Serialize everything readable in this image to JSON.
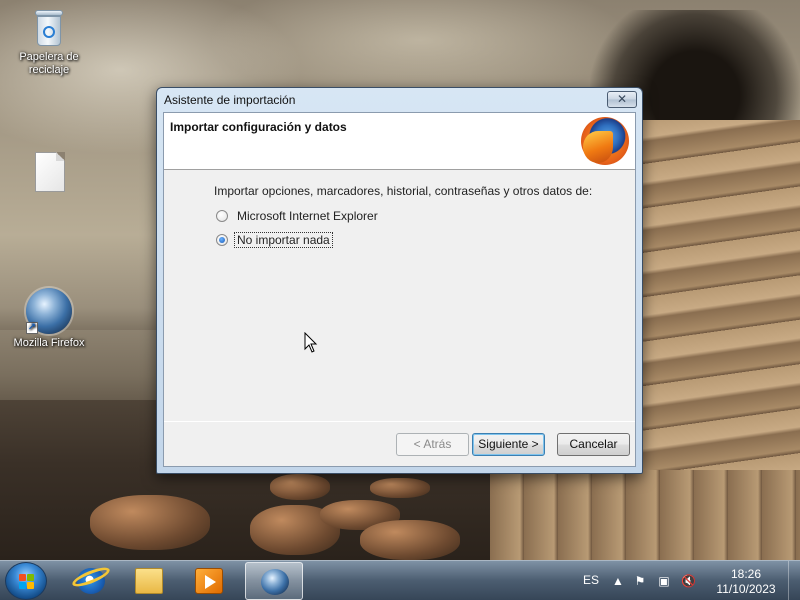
{
  "desktop": {
    "icons": [
      {
        "label": "Papelera de reciclaje",
        "icon": "recycle-bin-icon"
      },
      {
        "label": "",
        "icon": "blank-file-icon"
      },
      {
        "label": "Mozilla Firefox",
        "icon": "firefox-icon"
      }
    ]
  },
  "dialog": {
    "title": "Asistente de importación",
    "close_label": "✕",
    "header_title": "Importar configuración y datos",
    "logo_icon": "firefox-logo-icon",
    "prompt": "Importar opciones, marcadores, historial, contraseñas y otros datos de:",
    "options": [
      {
        "label": "Microsoft Internet Explorer",
        "checked": false
      },
      {
        "label": "No importar nada",
        "checked": true
      }
    ],
    "buttons": {
      "back": "< Atrás",
      "next": "Siguiente >",
      "cancel": "Cancelar"
    }
  },
  "taskbar": {
    "pinned": [
      {
        "icon": "start-orb-icon"
      },
      {
        "icon": "internet-explorer-icon"
      },
      {
        "icon": "file-explorer-icon"
      },
      {
        "icon": "media-player-icon"
      },
      {
        "icon": "firefox-icon",
        "active": true
      }
    ],
    "language": "ES",
    "tray_icons": [
      "show-hidden-icons-icon",
      "action-center-flag-icon",
      "network-icon",
      "volume-muted-icon"
    ],
    "time": "18:26",
    "date": "11/10/2023"
  }
}
